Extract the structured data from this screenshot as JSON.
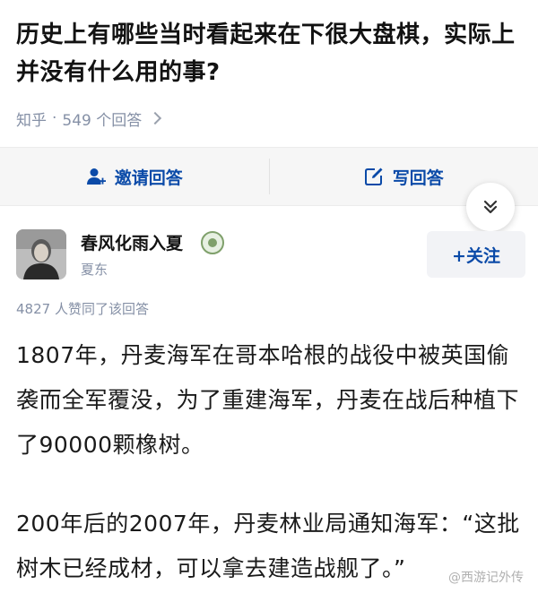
{
  "question": {
    "title": "历史上有哪些当时看起来在下很大盘棋，实际上并没有什么用的事?",
    "source": "知乎",
    "answer_count": "549 个回答"
  },
  "actions": {
    "invite_label": "邀请回答",
    "write_label": "写回答"
  },
  "author": {
    "name": "春风化雨入夏",
    "subtitle": "夏东",
    "follow_label": "+关注"
  },
  "answer": {
    "upvotes": "4827 人赞同了该回答",
    "paragraphs": [
      "1807年，丹麦海军在哥本哈根的战役中被英国偷袭而全军覆没，为了重建海军，丹麦在战后种植下了90000颗橡树。",
      "200年后的2007年，丹麦林业局通知海军：“这批树木已经成材，可以拿去建造战舰了。”"
    ]
  },
  "watermark": "@西游记外传",
  "colors": {
    "accent": "#0a4aa8",
    "muted": "#8590a6",
    "action_bar_bg": "#f6f6f6"
  }
}
